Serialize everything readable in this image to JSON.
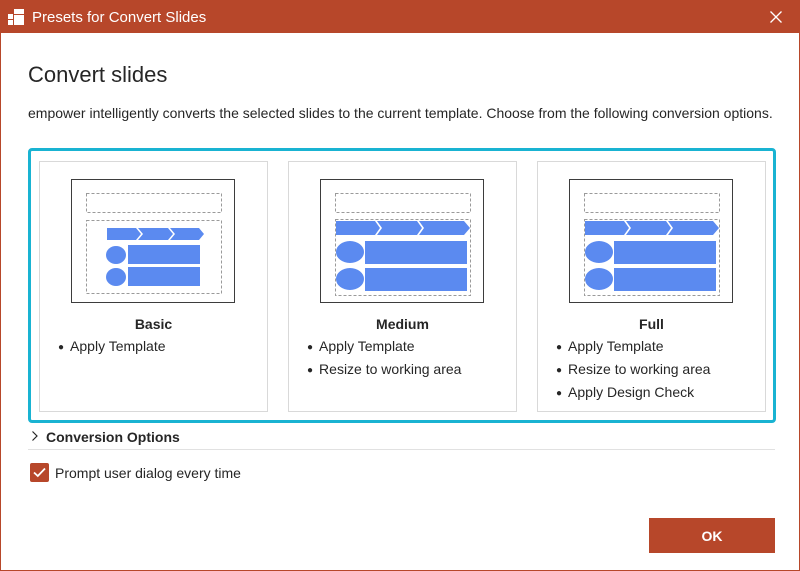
{
  "window": {
    "title": "Presets for Convert Slides",
    "accent_color": "#b7472a",
    "icons": {
      "app": "app-logo-icon",
      "close": "close-icon"
    }
  },
  "content": {
    "heading": "Convert slides",
    "description": "empower intelligently converts the selected slides to the current template. Choose from the following conversion options.",
    "highlight_color": "#19b3d2"
  },
  "presets": [
    {
      "title": "Basic",
      "bullets": [
        "Apply Template"
      ],
      "selected": true
    },
    {
      "title": "Medium",
      "bullets": [
        "Apply Template",
        "Resize to working area"
      ],
      "selected": false
    },
    {
      "title": "Full",
      "bullets": [
        "Apply Template",
        "Resize to working area",
        "Apply Design Check"
      ],
      "selected": false
    }
  ],
  "conversion_options": {
    "label": "Conversion Options",
    "expanded": false,
    "icon": "chevron-right-icon"
  },
  "prompt_checkbox": {
    "label": "Prompt user dialog every time",
    "checked": true
  },
  "ok_button": {
    "label": "OK"
  }
}
